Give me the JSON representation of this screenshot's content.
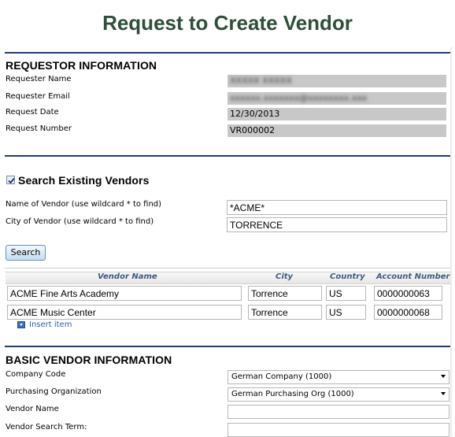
{
  "page": {
    "title": "Request to Create Vendor"
  },
  "requestor": {
    "heading": "REQUESTOR INFORMATION",
    "fields": [
      {
        "label": "Requester Name",
        "value": "XXXXX XXXXX"
      },
      {
        "label": "Requester Email",
        "value": "xxxxxx.xxxxxxx@xxxxxxxx.xxx"
      },
      {
        "label": "Request Date",
        "value": "12/30/2013"
      },
      {
        "label": "Request Number",
        "value": "VR000002"
      }
    ]
  },
  "search": {
    "checkbox_checked": true,
    "heading": "Search Existing Vendors",
    "name_label": "Name of Vendor (use wildcard * to find)",
    "name_value": "*ACME*",
    "city_label": "City of Vendor (use wildcard * to find)",
    "city_value": "TORRENCE",
    "button_label": "Search"
  },
  "results": {
    "columns": [
      "Vendor Name",
      "City",
      "Country",
      "Account Number"
    ],
    "rows": [
      [
        "ACME Fine Arts Academy",
        "Torrence",
        "US",
        "0000000063"
      ],
      [
        "ACME Music Center",
        "Torrence",
        "US",
        "0000000068"
      ]
    ],
    "insert_label": "Insert item"
  },
  "basic": {
    "heading": "BASIC VENDOR INFORMATION",
    "company_code_label": "Company Code",
    "company_code_value": "German Company (1000)",
    "purch_org_label": "Purchasing Organization",
    "purch_org_value": "German Purchasing Org (1000)",
    "vendor_name_label": "Vendor Name",
    "vendor_name_value": "",
    "search_term_label": "Vendor Search Term:",
    "search_term_value": ""
  }
}
